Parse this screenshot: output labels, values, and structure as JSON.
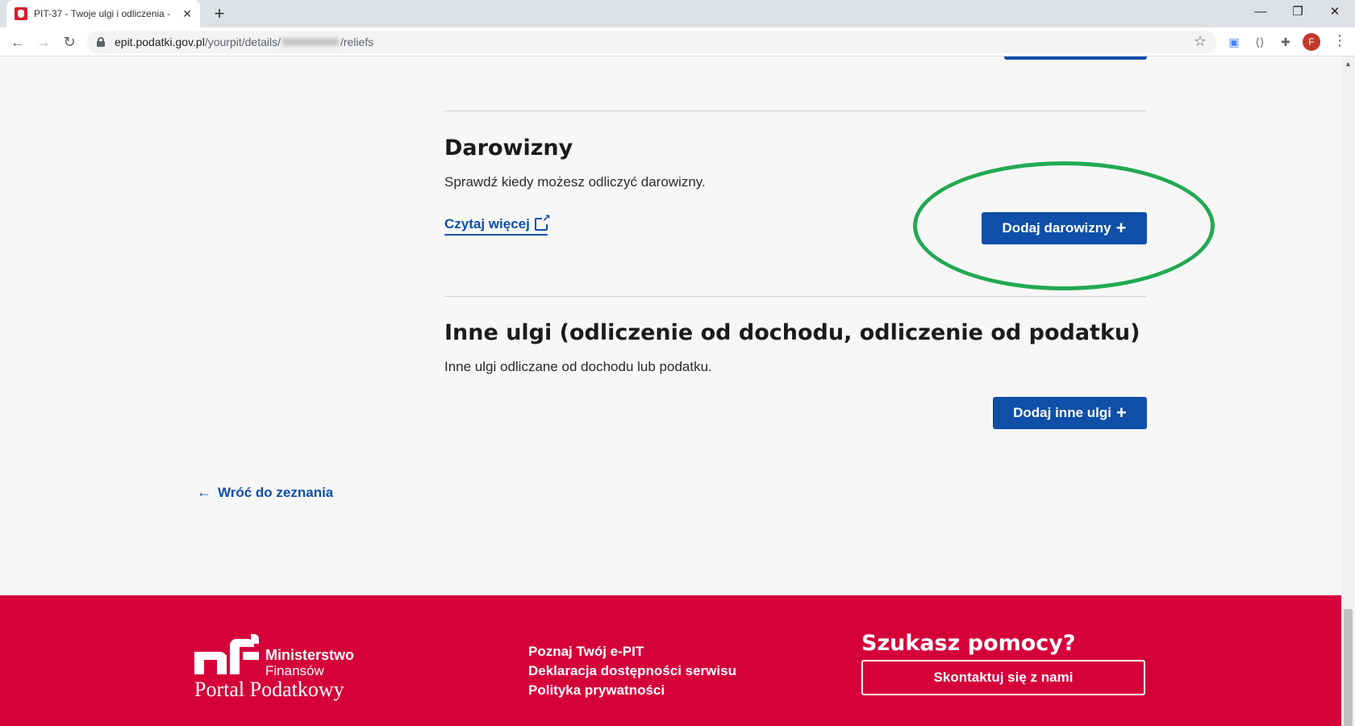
{
  "browser": {
    "tab_title": "PIT-37 - Twoje ulgi i odliczenia -",
    "tab_close": "✕",
    "new_tab": "+",
    "url_host": "epit.podatki.gov.pl",
    "url_path_1": "/yourpit/details/",
    "url_path_2": "/reliefs",
    "avatar_letter": "F"
  },
  "sections": {
    "darowizny": {
      "title": "Darowizny",
      "description": "Sprawdź kiedy możesz odliczyć darowizny.",
      "read_more": "Czytaj więcej",
      "button": "Dodaj darowizny"
    },
    "inne": {
      "title": "Inne ulgi (odliczenie od dochodu, odliczenie od podatku)",
      "description": "Inne ulgi odliczane od dochodu lub podatku.",
      "button": "Dodaj inne ulgi"
    }
  },
  "back_link": "Wróć do zeznania",
  "footer": {
    "logo_line1": "Ministerstwo",
    "logo_line2": "Finansów",
    "logo_line3": "Portal Podatkowy",
    "links": [
      "Poznaj Twój e-PIT",
      "Deklaracja dostępności serwisu",
      "Polityka prywatności"
    ],
    "help_title": "Szukasz pomocy?",
    "help_button": "Skontaktuj się z nami"
  },
  "colors": {
    "primary": "#0f4fa8",
    "footer_bg": "#d5003a",
    "highlight": "#22a952"
  }
}
